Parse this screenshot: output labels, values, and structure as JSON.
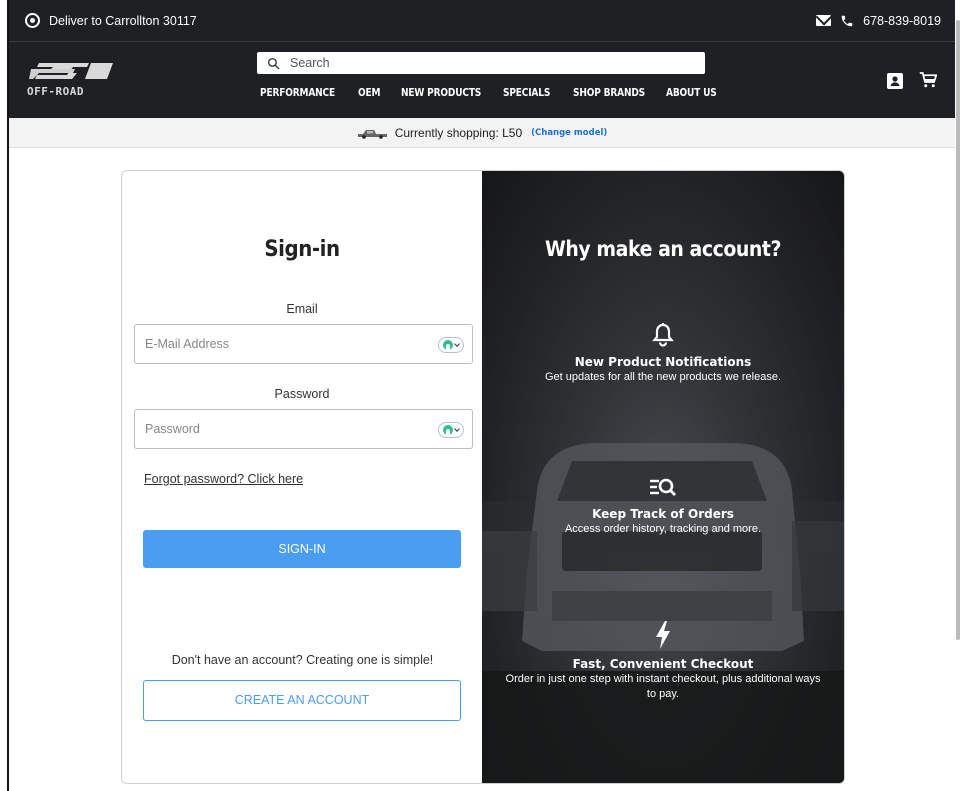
{
  "topbar": {
    "deliver_text": "Deliver to Carrollton 30117",
    "phone": "678-839-8019"
  },
  "header": {
    "logo_text": "OFF-ROAD",
    "search_placeholder": "Search",
    "nav": [
      "PERFORMANCE",
      "OEM",
      "NEW PRODUCTS",
      "SPECIALS",
      "SHOP BRANDS",
      "ABOUT US"
    ]
  },
  "modelbar": {
    "text": "Currently shopping: L50",
    "change_link": "(Change model)"
  },
  "signin": {
    "title": "Sign-in",
    "email_label": "Email",
    "email_placeholder": "E-Mail Address",
    "password_label": "Password",
    "password_placeholder": "Password",
    "forgot": "Forgot password? Click here",
    "submit": "SIGN-IN",
    "no_account": "Don't have an account? Creating one is simple!",
    "create": "CREATE AN ACCOUNT"
  },
  "why": {
    "title": "Why make an account?",
    "benefits": [
      {
        "icon": "bell-icon",
        "title": "New Product Notifications",
        "desc": "Get updates for all the new products we release."
      },
      {
        "icon": "order-search-icon",
        "title": "Keep Track of Orders",
        "desc": "Access order history, tracking and more."
      },
      {
        "icon": "lightning-icon",
        "title": "Fast, Convenient Checkout",
        "desc": "Order in just one step with instant checkout, plus additional ways to pay."
      }
    ]
  },
  "colors": {
    "header_bg": "#1e2023",
    "primary_button": "#4a9df0",
    "link_blue": "#1f6fd1"
  }
}
